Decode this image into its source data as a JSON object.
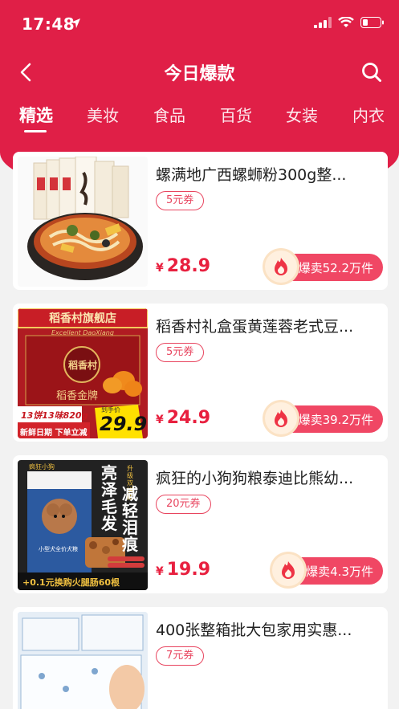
{
  "status": {
    "time": "17:48"
  },
  "nav": {
    "title": "今日爆款"
  },
  "tabs": [
    "精选",
    "美妆",
    "食品",
    "百货",
    "女装",
    "内衣"
  ],
  "products": [
    {
      "title": "螺满地广西螺蛳粉300g整...",
      "coupon": "5元券",
      "currency": "¥",
      "price": "28.9",
      "sales": "爆卖52.2万件"
    },
    {
      "title": "稻香村礼盒蛋黄莲蓉老式豆...",
      "coupon": "5元券",
      "currency": "¥",
      "price": "24.9",
      "sales": "爆卖39.2万件",
      "image_text": {
        "store": "稻香村旗舰店",
        "brand": "稻香村",
        "subtitle": "稻香金牌",
        "en": "Excellent DaoXiang",
        "deal": "13饼13味820g",
        "date": "新鲜日期 下单立减",
        "price_label": "到手价",
        "price": "29.9",
        "unit": "元"
      }
    },
    {
      "title": "疯狂的小狗狗粮泰迪比熊幼...",
      "coupon": "20元券",
      "currency": "¥",
      "price": "19.9",
      "sales": "爆卖4.3万件",
      "image_text": {
        "brand": "疯狂小狗",
        "slogan1": "亮泽毛发",
        "slogan2": "减轻泪痕",
        "tag": "升级双拼粮",
        "pack": "小型犬全价犬粮",
        "promo": "+0.1元换购火腿肠60根"
      }
    },
    {
      "title": "400张整箱批大包家用实惠...",
      "coupon": "7元券",
      "currency": "¥",
      "price": "",
      "sales": ""
    }
  ],
  "colors": {
    "brand": "#e01f47",
    "price": "#e8203f",
    "badge": "#f04764"
  }
}
